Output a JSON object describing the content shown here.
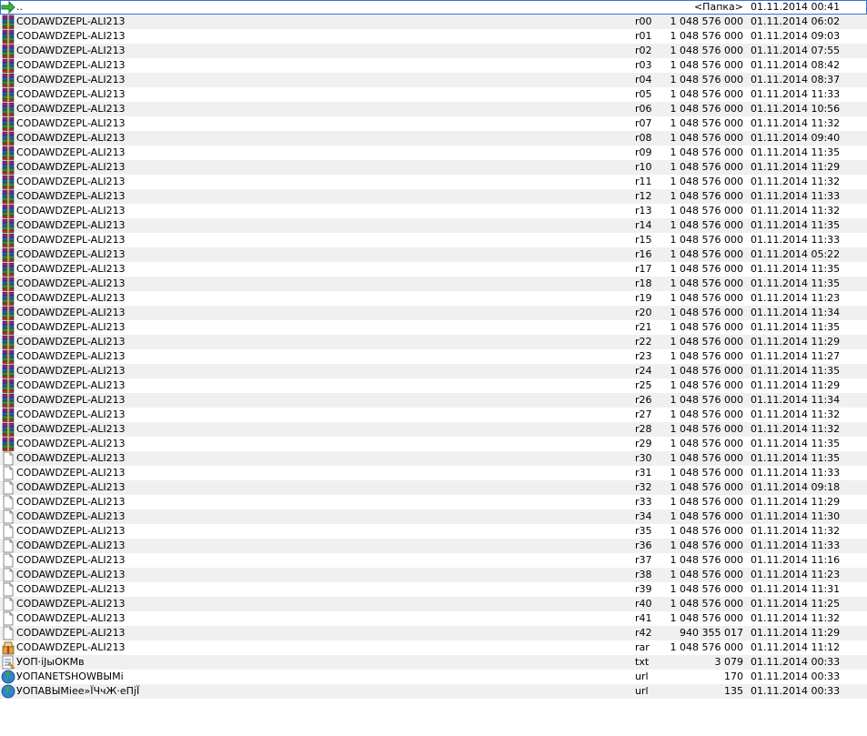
{
  "rows": [
    {
      "icon": "up",
      "name": "..",
      "ext": "",
      "size": "<Папка>",
      "date": "01.11.2014 00:41"
    },
    {
      "icon": "rar",
      "name": "CODAWDZEPL-ALI213",
      "ext": "r00",
      "size": "1 048 576 000",
      "date": "01.11.2014 06:02"
    },
    {
      "icon": "rar",
      "name": "CODAWDZEPL-ALI213",
      "ext": "r01",
      "size": "1 048 576 000",
      "date": "01.11.2014 09:03"
    },
    {
      "icon": "rar",
      "name": "CODAWDZEPL-ALI213",
      "ext": "r02",
      "size": "1 048 576 000",
      "date": "01.11.2014 07:55"
    },
    {
      "icon": "rar",
      "name": "CODAWDZEPL-ALI213",
      "ext": "r03",
      "size": "1 048 576 000",
      "date": "01.11.2014 08:42"
    },
    {
      "icon": "rar",
      "name": "CODAWDZEPL-ALI213",
      "ext": "r04",
      "size": "1 048 576 000",
      "date": "01.11.2014 08:37"
    },
    {
      "icon": "rar",
      "name": "CODAWDZEPL-ALI213",
      "ext": "r05",
      "size": "1 048 576 000",
      "date": "01.11.2014 11:33"
    },
    {
      "icon": "rar",
      "name": "CODAWDZEPL-ALI213",
      "ext": "r06",
      "size": "1 048 576 000",
      "date": "01.11.2014 10:56"
    },
    {
      "icon": "rar",
      "name": "CODAWDZEPL-ALI213",
      "ext": "r07",
      "size": "1 048 576 000",
      "date": "01.11.2014 11:32"
    },
    {
      "icon": "rar",
      "name": "CODAWDZEPL-ALI213",
      "ext": "r08",
      "size": "1 048 576 000",
      "date": "01.11.2014 09:40"
    },
    {
      "icon": "rar",
      "name": "CODAWDZEPL-ALI213",
      "ext": "r09",
      "size": "1 048 576 000",
      "date": "01.11.2014 11:35"
    },
    {
      "icon": "rar",
      "name": "CODAWDZEPL-ALI213",
      "ext": "r10",
      "size": "1 048 576 000",
      "date": "01.11.2014 11:29"
    },
    {
      "icon": "rar",
      "name": "CODAWDZEPL-ALI213",
      "ext": "r11",
      "size": "1 048 576 000",
      "date": "01.11.2014 11:32"
    },
    {
      "icon": "rar",
      "name": "CODAWDZEPL-ALI213",
      "ext": "r12",
      "size": "1 048 576 000",
      "date": "01.11.2014 11:33"
    },
    {
      "icon": "rar",
      "name": "CODAWDZEPL-ALI213",
      "ext": "r13",
      "size": "1 048 576 000",
      "date": "01.11.2014 11:32"
    },
    {
      "icon": "rar",
      "name": "CODAWDZEPL-ALI213",
      "ext": "r14",
      "size": "1 048 576 000",
      "date": "01.11.2014 11:35"
    },
    {
      "icon": "rar",
      "name": "CODAWDZEPL-ALI213",
      "ext": "r15",
      "size": "1 048 576 000",
      "date": "01.11.2014 11:33"
    },
    {
      "icon": "rar",
      "name": "CODAWDZEPL-ALI213",
      "ext": "r16",
      "size": "1 048 576 000",
      "date": "01.11.2014 05:22"
    },
    {
      "icon": "rar",
      "name": "CODAWDZEPL-ALI213",
      "ext": "r17",
      "size": "1 048 576 000",
      "date": "01.11.2014 11:35"
    },
    {
      "icon": "rar",
      "name": "CODAWDZEPL-ALI213",
      "ext": "r18",
      "size": "1 048 576 000",
      "date": "01.11.2014 11:35"
    },
    {
      "icon": "rar",
      "name": "CODAWDZEPL-ALI213",
      "ext": "r19",
      "size": "1 048 576 000",
      "date": "01.11.2014 11:23"
    },
    {
      "icon": "rar",
      "name": "CODAWDZEPL-ALI213",
      "ext": "r20",
      "size": "1 048 576 000",
      "date": "01.11.2014 11:34"
    },
    {
      "icon": "rar",
      "name": "CODAWDZEPL-ALI213",
      "ext": "r21",
      "size": "1 048 576 000",
      "date": "01.11.2014 11:35"
    },
    {
      "icon": "rar",
      "name": "CODAWDZEPL-ALI213",
      "ext": "r22",
      "size": "1 048 576 000",
      "date": "01.11.2014 11:29"
    },
    {
      "icon": "rar",
      "name": "CODAWDZEPL-ALI213",
      "ext": "r23",
      "size": "1 048 576 000",
      "date": "01.11.2014 11:27"
    },
    {
      "icon": "rar",
      "name": "CODAWDZEPL-ALI213",
      "ext": "r24",
      "size": "1 048 576 000",
      "date": "01.11.2014 11:35"
    },
    {
      "icon": "rar",
      "name": "CODAWDZEPL-ALI213",
      "ext": "r25",
      "size": "1 048 576 000",
      "date": "01.11.2014 11:29"
    },
    {
      "icon": "rar",
      "name": "CODAWDZEPL-ALI213",
      "ext": "r26",
      "size": "1 048 576 000",
      "date": "01.11.2014 11:34"
    },
    {
      "icon": "rar",
      "name": "CODAWDZEPL-ALI213",
      "ext": "r27",
      "size": "1 048 576 000",
      "date": "01.11.2014 11:32"
    },
    {
      "icon": "rar",
      "name": "CODAWDZEPL-ALI213",
      "ext": "r28",
      "size": "1 048 576 000",
      "date": "01.11.2014 11:32"
    },
    {
      "icon": "rar",
      "name": "CODAWDZEPL-ALI213",
      "ext": "r29",
      "size": "1 048 576 000",
      "date": "01.11.2014 11:35"
    },
    {
      "icon": "file",
      "name": "CODAWDZEPL-ALI213",
      "ext": "r30",
      "size": "1 048 576 000",
      "date": "01.11.2014 11:35"
    },
    {
      "icon": "file",
      "name": "CODAWDZEPL-ALI213",
      "ext": "r31",
      "size": "1 048 576 000",
      "date": "01.11.2014 11:33"
    },
    {
      "icon": "file",
      "name": "CODAWDZEPL-ALI213",
      "ext": "r32",
      "size": "1 048 576 000",
      "date": "01.11.2014 09:18"
    },
    {
      "icon": "file",
      "name": "CODAWDZEPL-ALI213",
      "ext": "r33",
      "size": "1 048 576 000",
      "date": "01.11.2014 11:29"
    },
    {
      "icon": "file",
      "name": "CODAWDZEPL-ALI213",
      "ext": "r34",
      "size": "1 048 576 000",
      "date": "01.11.2014 11:30"
    },
    {
      "icon": "file",
      "name": "CODAWDZEPL-ALI213",
      "ext": "r35",
      "size": "1 048 576 000",
      "date": "01.11.2014 11:32"
    },
    {
      "icon": "file",
      "name": "CODAWDZEPL-ALI213",
      "ext": "r36",
      "size": "1 048 576 000",
      "date": "01.11.2014 11:33"
    },
    {
      "icon": "file",
      "name": "CODAWDZEPL-ALI213",
      "ext": "r37",
      "size": "1 048 576 000",
      "date": "01.11.2014 11:16"
    },
    {
      "icon": "file",
      "name": "CODAWDZEPL-ALI213",
      "ext": "r38",
      "size": "1 048 576 000",
      "date": "01.11.2014 11:23"
    },
    {
      "icon": "file",
      "name": "CODAWDZEPL-ALI213",
      "ext": "r39",
      "size": "1 048 576 000",
      "date": "01.11.2014 11:31"
    },
    {
      "icon": "file",
      "name": "CODAWDZEPL-ALI213",
      "ext": "r40",
      "size": "1 048 576 000",
      "date": "01.11.2014 11:25"
    },
    {
      "icon": "file",
      "name": "CODAWDZEPL-ALI213",
      "ext": "r41",
      "size": "1 048 576 000",
      "date": "01.11.2014 11:32"
    },
    {
      "icon": "file",
      "name": "CODAWDZEPL-ALI213",
      "ext": "r42",
      "size": "940 355 017",
      "date": "01.11.2014 11:29"
    },
    {
      "icon": "rar-main",
      "name": "CODAWDZEPL-ALI213",
      "ext": "rar",
      "size": "1 048 576 000",
      "date": "01.11.2014 11:12"
    },
    {
      "icon": "txt",
      "name": "УОП·іЈыОКМв",
      "ext": "txt",
      "size": "3 079",
      "date": "01.11.2014 00:33"
    },
    {
      "icon": "url",
      "name": "УОПANETSHOWВЫМі",
      "ext": "url",
      "size": "170",
      "date": "01.11.2014 00:33"
    },
    {
      "icon": "url",
      "name": "УОПАВЫМіее»ЇЧчЖ·еПјЇ",
      "ext": "url",
      "size": "135",
      "date": "01.11.2014 00:33"
    }
  ],
  "icons": {
    "up": "up-arrow-icon",
    "rar": "winrar-archive-icon",
    "file": "blank-file-icon",
    "rar-main": "archive-package-icon",
    "txt": "text-document-icon",
    "url": "globe-icon"
  }
}
